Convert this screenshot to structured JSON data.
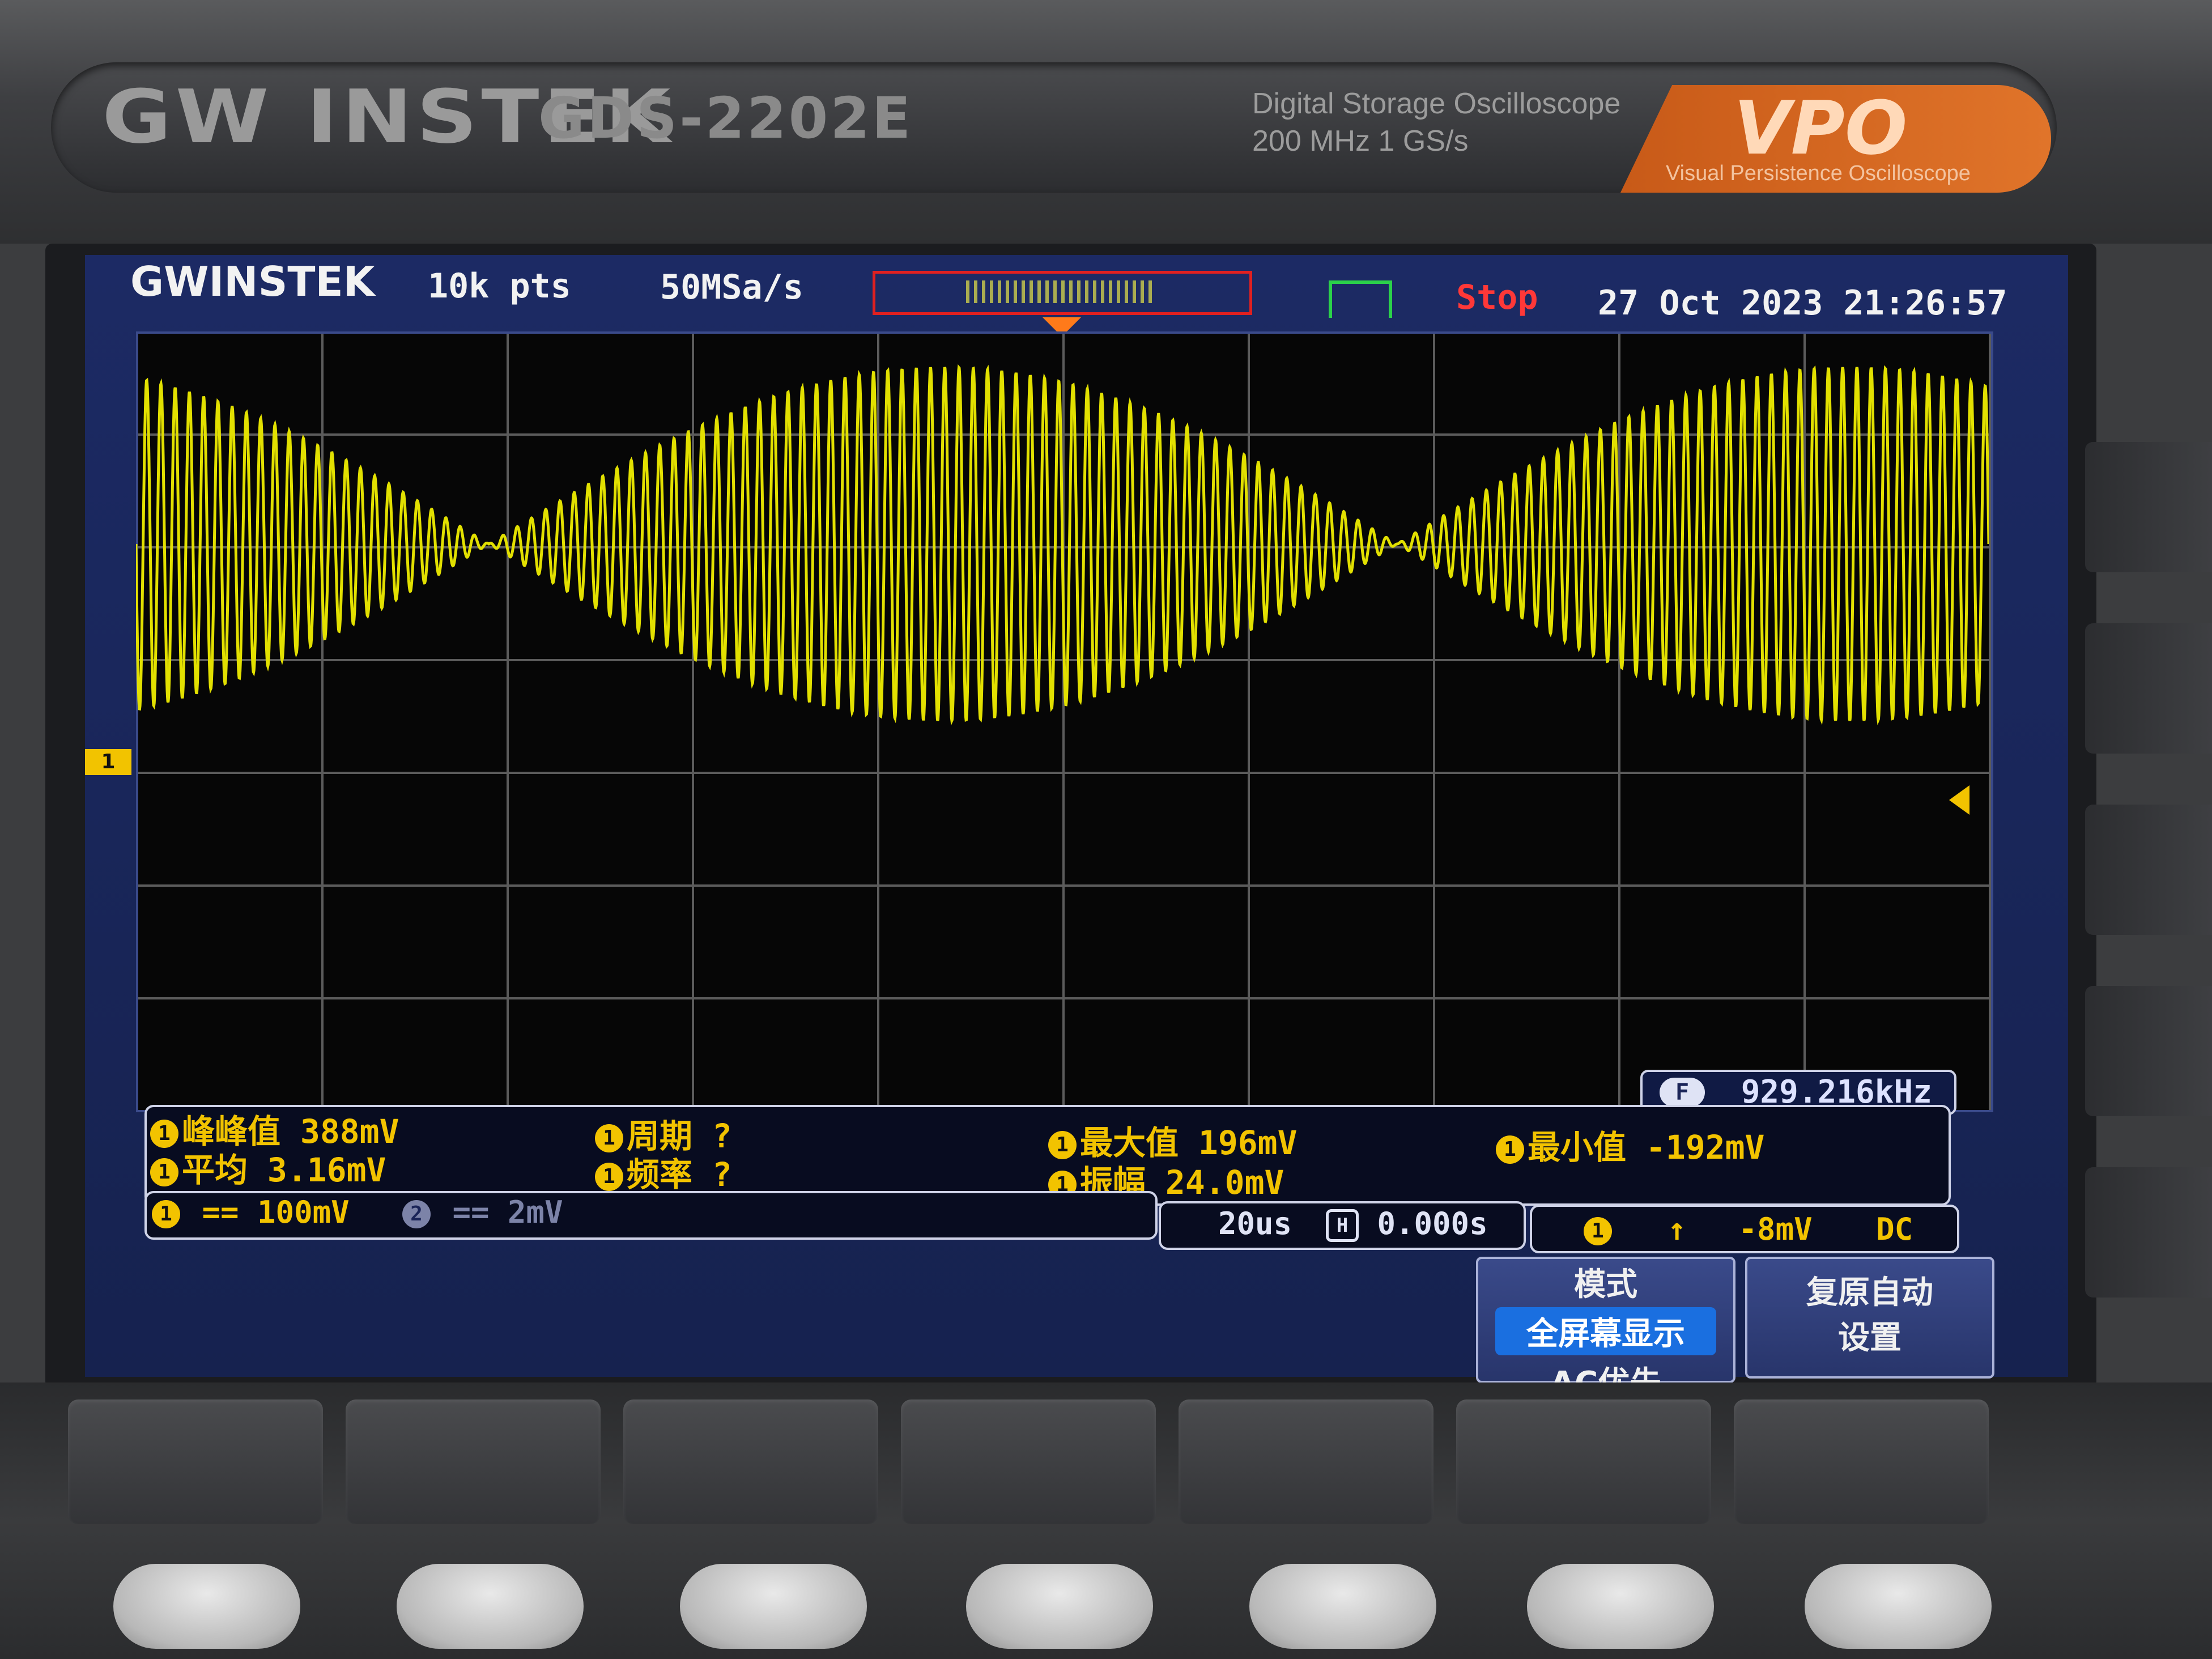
{
  "brand": {
    "logo": "GW INSTEK",
    "model": "GDS-2202E",
    "description_line1": "Digital  Storage  Oscilloscope",
    "description_line2": "200 MHz   1 GS/s",
    "vpo_logo": "VPO",
    "vpo_subtitle": "Visual Persistence Oscilloscope"
  },
  "header": {
    "logo": "GWINSTEK",
    "record_length": "10k pts",
    "sample_rate": "50MSa/s",
    "run_status": "Stop",
    "datetime": "27 Oct 2023 21:26:57"
  },
  "waveform": {
    "description": "amplitude-modulated sine",
    "color": "#e2e000",
    "carrier_cycles_visible": 130,
    "envelope_cycles_visible": 2,
    "envelope_amplitude_divisions": 1.6
  },
  "markers": {
    "channel_label": "1"
  },
  "frequency_counter": {
    "icon": "F",
    "value": "929.216kHz"
  },
  "measurements": {
    "peak_to_peak": "峰峰值 388mV",
    "mean": "平均 3.16mV",
    "period": "周期 ?",
    "frequency": "频率 ?",
    "max": "最大值 196mV",
    "amplitude": "振幅 24.0mV",
    "min": "最小值 -192mV",
    "channel": "1"
  },
  "status_bar": {
    "ch1_label": "1",
    "ch1_coupling_icon": "dc-coupling-icon",
    "ch1_scale": "== 100mV",
    "ch2_label": "2",
    "ch2_scale": "== 2mV",
    "timebase": "20us",
    "h_icon": "H",
    "h_position": "0.000s",
    "trigger_channel": "1",
    "trigger_slope_icon": "rising-edge-icon",
    "trigger_slope": "↑",
    "trigger_level": "-8mV",
    "trigger_coupling": "DC"
  },
  "soft_menu": {
    "mode_title": "模式",
    "mode_selected": "全屏幕显示",
    "mode_option": "AC优先",
    "autoset_line1": "复原自动",
    "autoset_line2": "设置"
  }
}
